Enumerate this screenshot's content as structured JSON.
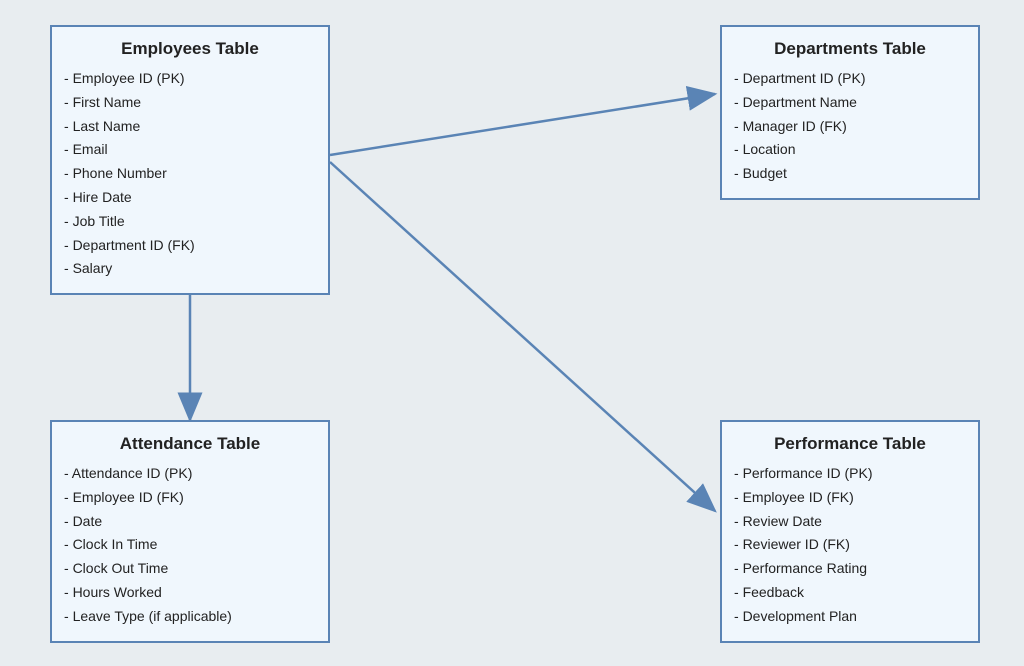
{
  "tables": {
    "employees": {
      "title": "Employees Table",
      "fields": [
        "Employee ID (PK)",
        "First Name",
        "Last Name",
        "Email",
        "Phone Number",
        "Hire Date",
        "Job Title",
        "Department ID (FK)",
        "Salary"
      ]
    },
    "departments": {
      "title": "Departments Table",
      "fields": [
        "Department ID (PK)",
        "Department Name",
        "Manager ID (FK)",
        "Location",
        "Budget"
      ]
    },
    "attendance": {
      "title": "Attendance Table",
      "fields": [
        "Attendance ID (PK)",
        "Employee ID (FK)",
        "Date",
        "Clock In Time",
        "Clock Out Time",
        "Hours Worked",
        "Leave Type (if applicable)"
      ]
    },
    "performance": {
      "title": "Performance Table",
      "fields": [
        "Performance ID (PK)",
        "Employee ID (FK)",
        "Review Date",
        "Reviewer ID (FK)",
        "Performance Rating",
        "Feedback",
        "Development Plan"
      ]
    }
  },
  "connectors": [
    {
      "from": "employees",
      "to": "departments"
    },
    {
      "from": "employees",
      "to": "attendance"
    },
    {
      "from": "employees",
      "to": "performance"
    }
  ],
  "colors": {
    "box_border": "#5a84b5",
    "box_fill": "#f0f7fd",
    "canvas_bg": "#e8edf0",
    "arrow": "#5a84b5"
  }
}
